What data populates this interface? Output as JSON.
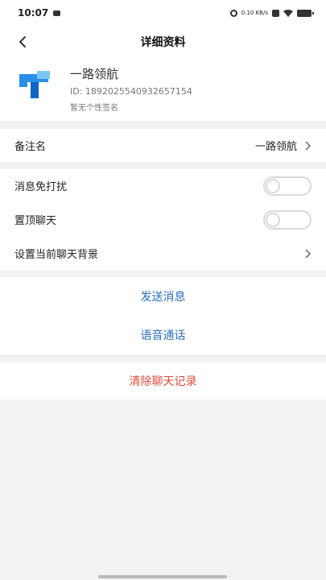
{
  "status_bar": {
    "time": "10:07",
    "speed": "0.10 KB/s",
    "icons": [
      "message-icon",
      "vibrate-icon",
      "data-icon",
      "wifi-icon",
      "battery-icon"
    ]
  },
  "nav": {
    "title": "详细资料",
    "back_icon": "back-arrow-icon"
  },
  "profile": {
    "name": "一路领航",
    "id": "ID: 1892025540932657154",
    "signature": "暂无个性签名",
    "avatar_icon": "app-logo",
    "avatar_colors": [
      "#2a8fe8",
      "#7cc7f2",
      "#0f63c9"
    ]
  },
  "remark": {
    "label": "备注名",
    "value": "一路领航"
  },
  "settings": {
    "dnd_label": "消息免打扰",
    "dnd_on": false,
    "pin_label": "置顶聊天",
    "pin_on": false,
    "background_label": "设置当前聊天背景"
  },
  "actions": {
    "send_message": "发送消息",
    "voice_call": "语音通话",
    "clear_history": "清除聊天记录"
  },
  "colors": {
    "link_blue": "#2a6fbd",
    "danger_red": "#e04a3b",
    "background": "#f2f2f4"
  }
}
